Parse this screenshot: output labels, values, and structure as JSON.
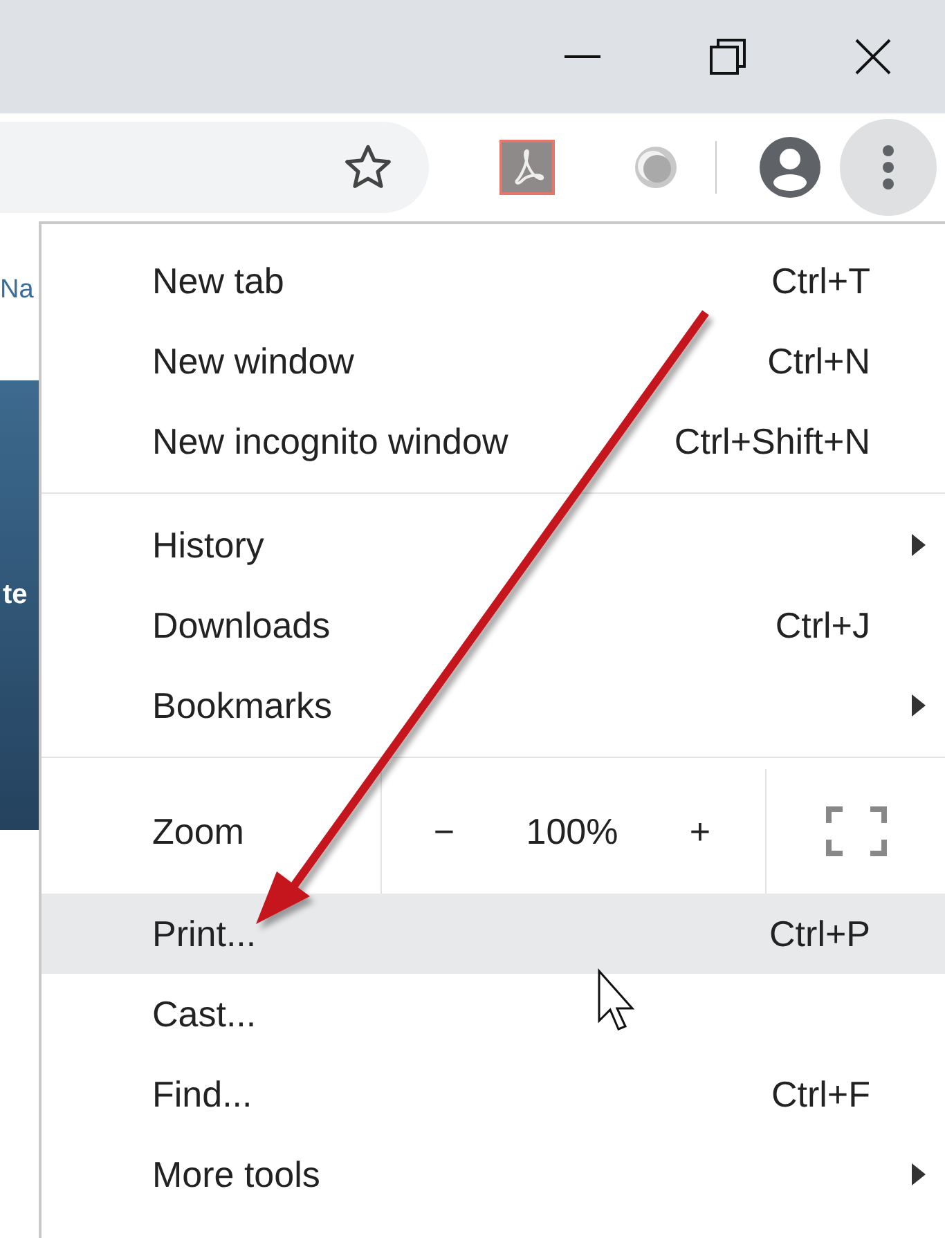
{
  "page_behind": {
    "texts": [
      "Na",
      "te"
    ]
  },
  "menu": {
    "items": [
      {
        "kind": "command",
        "label": "New tab",
        "shortcut": "Ctrl+T",
        "selected": false
      },
      {
        "kind": "command",
        "label": "New window",
        "shortcut": "Ctrl+N",
        "selected": false
      },
      {
        "kind": "command",
        "label": "New incognito window",
        "shortcut": "Ctrl+Shift+N",
        "selected": false
      },
      {
        "kind": "divider"
      },
      {
        "kind": "submenu",
        "label": "History",
        "selected": false
      },
      {
        "kind": "command",
        "label": "Downloads",
        "shortcut": "Ctrl+J",
        "selected": false
      },
      {
        "kind": "submenu",
        "label": "Bookmarks",
        "selected": false
      },
      {
        "kind": "divider"
      },
      {
        "kind": "zoom",
        "label": "Zoom",
        "minus": "−",
        "value": "100%",
        "plus": "+"
      },
      {
        "kind": "command",
        "label": "Print...",
        "shortcut": "Ctrl+P",
        "selected": true
      },
      {
        "kind": "command",
        "label": "Cast...",
        "selected": false
      },
      {
        "kind": "command",
        "label": "Find...",
        "shortcut": "Ctrl+F",
        "selected": false
      },
      {
        "kind": "submenu",
        "label": "More tools",
        "selected": false
      }
    ]
  }
}
